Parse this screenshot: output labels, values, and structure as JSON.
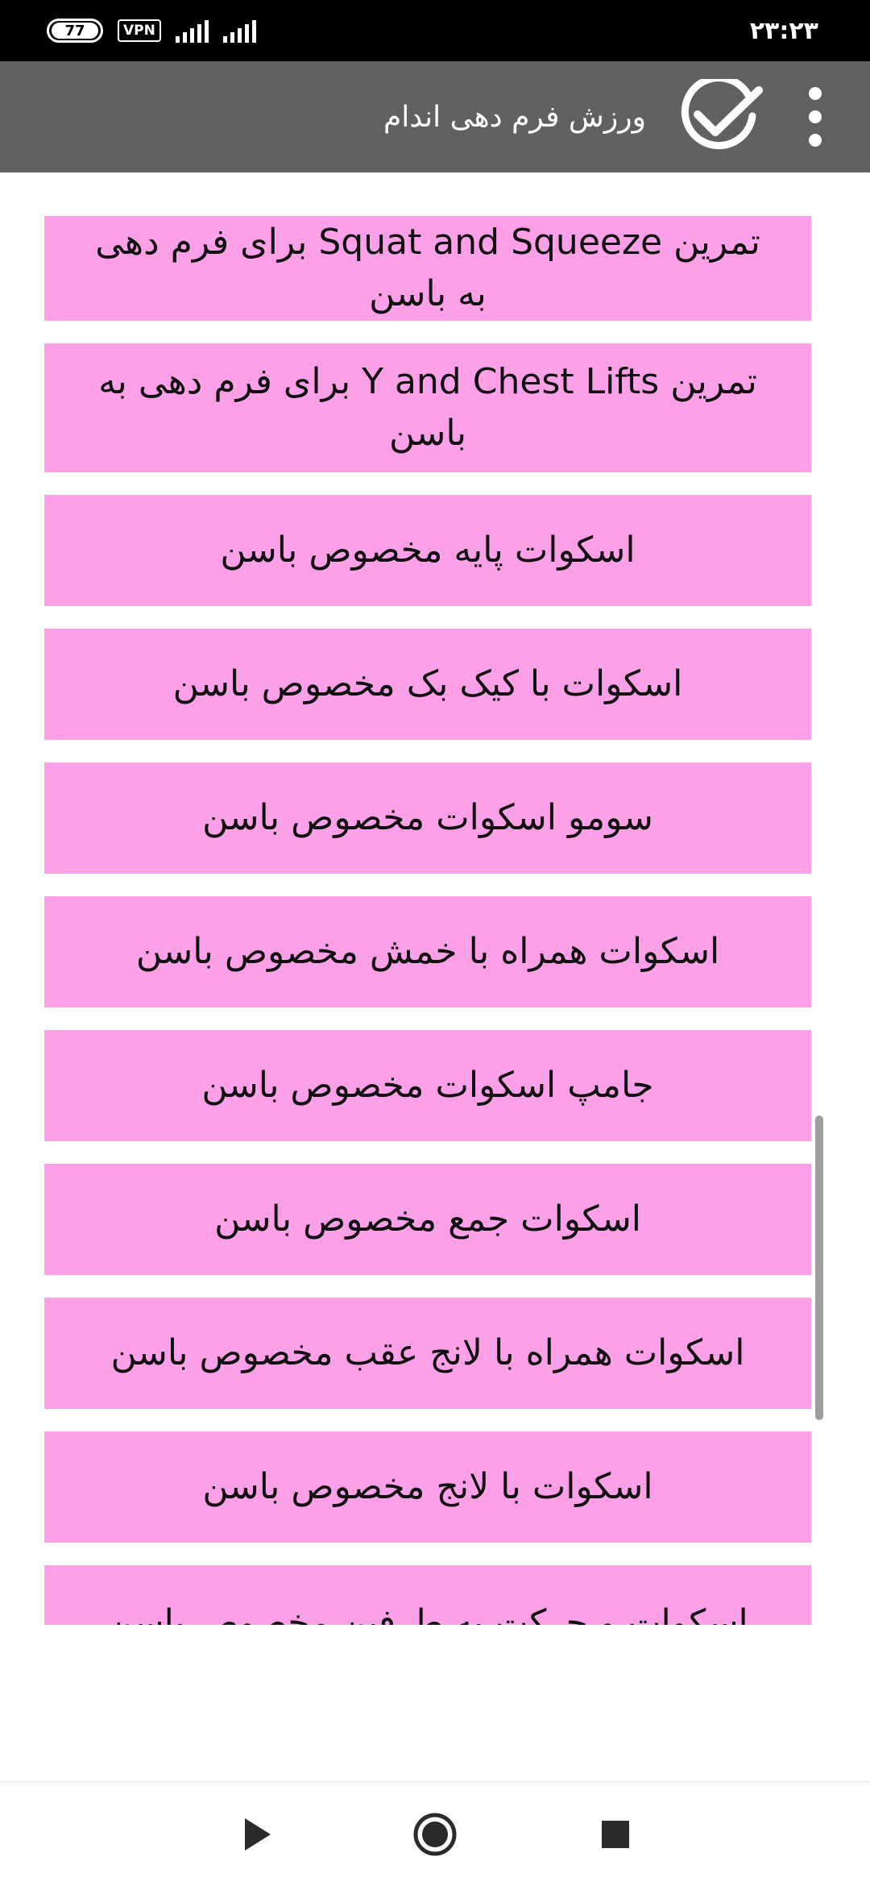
{
  "status_bar": {
    "time": "۲۳:۲۳",
    "battery": "77",
    "vpn": "VPN"
  },
  "app_bar": {
    "title": "ورزش فرم دهی اندام",
    "check_icon": "check-circle-icon",
    "menu_icon": "overflow-menu-icon"
  },
  "exercises": [
    "تمرین Squat and Squeeze برای فرم دهی به باسن",
    "تمرین Y and Chest Lifts برای فرم دهی به باسن",
    "اسکوات پایه مخصوص باسن",
    "اسکوات با کیک بک مخصوص باسن",
    "سومو اسکوات مخصوص باسن",
    "اسکوات همراه با خمش مخصوص باسن",
    "جامپ اسکوات مخصوص باسن",
    "اسکوات جمع مخصوص باسن",
    "اسکوات همراه با لانج عقب مخصوص باسن",
    "اسکوات با لانج مخصوص باسن",
    "اسکوات و حرکت به طرفین مخصوص باسن"
  ],
  "colors": {
    "item_bg": "#fca0e8",
    "app_bar": "#616161",
    "status_bar": "#000000"
  },
  "nav_bar": {
    "back_icon": "play-triangle-icon",
    "home_icon": "home-circle-icon",
    "recents_icon": "recents-square-icon"
  }
}
